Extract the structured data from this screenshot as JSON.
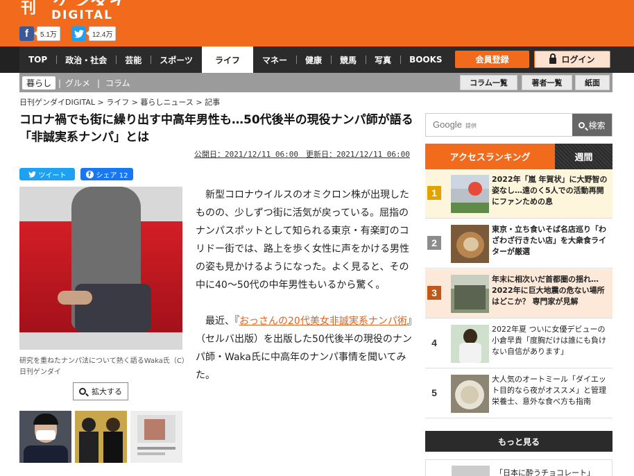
{
  "header": {
    "logo_kanji": "刊",
    "logo_main": "ゲンダイ",
    "logo_sub": "DIGITAL",
    "facebook_count": "5.1万",
    "twitter_count": "12.4万",
    "brand_color": "#f26a1b"
  },
  "nav": {
    "items": [
      "TOP",
      "政治・社会",
      "芸能",
      "スポーツ",
      "ライフ",
      "マネー",
      "健康",
      "競馬",
      "写真",
      "BOOKS"
    ],
    "active": "ライフ",
    "register_label": "会員登録",
    "login_label": "ログイン"
  },
  "subnav": {
    "items": [
      "暮らし",
      "グルメ",
      "コラム"
    ],
    "active": "暮らし",
    "right": [
      "コラム一覧",
      "著者一覧",
      "紙面"
    ]
  },
  "breadcrumb": "日刊ゲンダイDIGITAL > ライフ > 暮らしニュース > 記事",
  "article": {
    "title": "コロナ禍でも街に繰り出す中高年男性も…50代後半の現役ナンパ師が語る「非誠実系ナンパ」とは",
    "dates": "公開日：2021/12/11 06:00　更新日：2021/12/11 06:00",
    "share_twitter": "ツイート",
    "share_facebook": "シェア 12",
    "caption": "研究を重ねたナンパ法について熱く語るWaka氏（C）日刊ゲンダイ",
    "zoom_label": "拡大する",
    "para1": "新型コロナウイルスのオミクロン株が出現したものの、少しずつ街に活気が戻っている。屈指のナンパスポットとして知られる東京・有楽町のコリドー街では、路上を歩く女性に声をかける男性の姿も見かけるようになった。よく見ると、その中に40～50代の中年男性もいるから驚く。",
    "para2_pre": "最近、『",
    "para2_link": "おっさんの20代美女非誠実系ナンパ術",
    "para2_post": "』（セルバ出版）を出版した50代後半の現役のナンパ師・Waka氏に中高年のナンパ事情を聞いてみた。"
  },
  "sidebar": {
    "search_brand": "Google",
    "search_provider": "提供",
    "search_button": "検索",
    "ranking_title": "アクセスランキング",
    "ranking_tab": "週間",
    "ranking": [
      {
        "num": "1",
        "text": "2022年「嵐 年賀状」に大野智の姿なし…遠のく5人での活動再開にファンための息",
        "color": "#e0a300"
      },
      {
        "num": "2",
        "text": "東京・立ち食いそば名店巡り「わざわざ行きたい店」を大衆食ライターが厳選",
        "color": "#8c8c8c"
      },
      {
        "num": "3",
        "text": "年末に相次いだ首都圏の揺れ…2022年に巨大地震の危ない場所はどこか？ 専門家が見解",
        "color": "#c0581a"
      },
      {
        "num": "4",
        "text": "2022年夏 ついに女優デビューの小倉早貴「度胸だけは誰にも負けない自信があります」",
        "color": "#ffffff"
      },
      {
        "num": "5",
        "text": "大人気のオートミール「ダイエット目的なら夜がオススメ」と管理栄養士、意外な食べ方も指南",
        "color": "#ffffff"
      }
    ],
    "more_label": "もっと見る",
    "next_text": "「日本に酔うチョコレート」"
  }
}
